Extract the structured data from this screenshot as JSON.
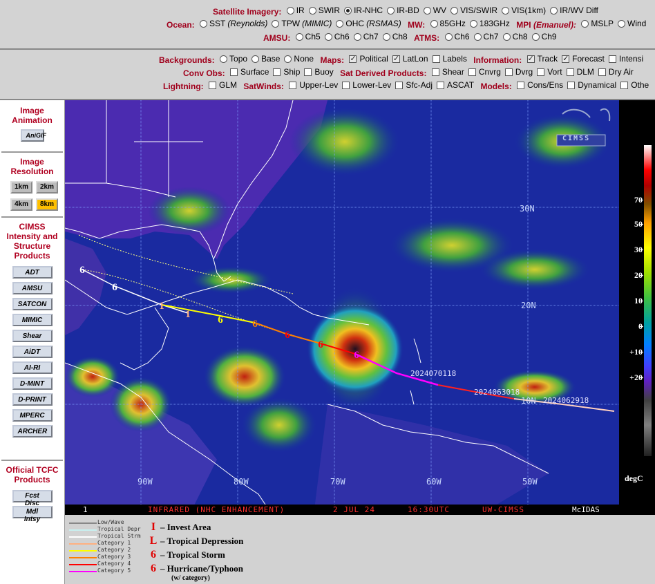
{
  "top": {
    "satellite_label": "Satellite Imagery:",
    "satellite_opts": [
      "IR",
      "SWIR",
      "IR-NHC",
      "IR-BD",
      "WV",
      "VIS/SWIR",
      "VIS(1km)",
      "IR/WV Diff"
    ],
    "satellite_selected": "IR-NHC",
    "ocean_label": "Ocean:",
    "ocean_opts": [
      "SST",
      "TPW",
      "OHC"
    ],
    "ocean_sub": [
      "(Reynolds)",
      "(MIMIC)",
      "(RSMAS)"
    ],
    "mw_label": "MW:",
    "mw_opts": [
      "85GHz",
      "183GHz"
    ],
    "mpi_label": "MPI",
    "mpi_sub": "(Emanuel):",
    "mpi_opts": [
      "MSLP",
      "Wind"
    ],
    "amsu_label": "AMSU:",
    "amsu_opts": [
      "Ch5",
      "Ch6",
      "Ch7",
      "Ch8"
    ],
    "atms_label": "ATMS:",
    "atms_opts": [
      "Ch6",
      "Ch7",
      "Ch8",
      "Ch9"
    ]
  },
  "second": {
    "backgrounds_label": "Backgrounds:",
    "backgrounds_opts": [
      "Topo",
      "Base",
      "None"
    ],
    "maps_label": "Maps:",
    "maps_opts": [
      "Political",
      "LatLon",
      "Labels"
    ],
    "info_label": "Information:",
    "info_opts": [
      "Track",
      "Forecast",
      "Intensi"
    ],
    "conv_label": "Conv Obs:",
    "conv_opts": [
      "Surface",
      "Ship",
      "Buoy"
    ],
    "satder_label": "Sat Derived Products:",
    "satder_opts": [
      "Shear",
      "Cnvrg",
      "Dvrg",
      "Vort",
      "DLM",
      "Dry Air"
    ],
    "lightning_label": "Lightning:",
    "lightning_opts": [
      "GLM"
    ],
    "satwinds_label": "SatWinds:",
    "satwinds_opts": [
      "Upper-Lev",
      "Lower-Lev",
      "Sfc-Adj",
      "ASCAT"
    ],
    "models_label": "Models:",
    "models_opts": [
      "Cons/Ens",
      "Dynamical",
      "Othe"
    ]
  },
  "sidebar": {
    "animation_title": "Image Animation",
    "anigif": "AniGIF",
    "resolution_title": "Image Resolution",
    "res": [
      "1km",
      "2km",
      "4km",
      "8km"
    ],
    "res_selected": "8km",
    "cimss_title": "CIMSS Intensity and Structure Products",
    "products": [
      "ADT",
      "AMSU",
      "SATCON",
      "MIMIC",
      "Shear",
      "AiDT",
      "AI-RI",
      "D-MINT",
      "D-PRINT",
      "MPERC",
      "ARCHER"
    ],
    "tcfc_title": "Official TCFC Products",
    "tcfc": [
      "Fcst Disc",
      "Mdl Intsy"
    ]
  },
  "map": {
    "lat_labels": [
      "30N",
      "20N",
      "10N"
    ],
    "lon_labels": [
      "90W",
      "80W",
      "70W",
      "60W",
      "50W"
    ],
    "track_labels": [
      "2024070118",
      "2024063018",
      "2024062918"
    ],
    "logo": "CIMSS",
    "status_num": "1",
    "status_text": "INFRARED (NHC ENHANCEMENT)",
    "status_date": "2 JUL 24",
    "status_time": "16:30UTC",
    "status_src": "UW-CIMSS",
    "status_mc": "McIDAS"
  },
  "colorbar": {
    "ticks": [
      "70",
      "50",
      "30",
      "20",
      "10",
      "0",
      "+10",
      "+20"
    ],
    "unit": "degC"
  },
  "legend": {
    "small": [
      "Low/Wave",
      "Tropical Depr",
      "Tropical Strm",
      "Category 1",
      "Category 2",
      "Category 3",
      "Category 4",
      "Category 5"
    ],
    "small_colors": [
      "#888888",
      "#c8f0f0",
      "#ffffff",
      "#ffb080",
      "#ffff00",
      "#ff8000",
      "#ff0000",
      "#ff00ff"
    ],
    "big": [
      "– Invest Area",
      "– Tropical Depression",
      "– Tropical Storm",
      "– Hurricane/Typhoon"
    ],
    "big_sub": "(w/ category)",
    "symbols": [
      "I",
      "L",
      "6",
      "6"
    ]
  }
}
